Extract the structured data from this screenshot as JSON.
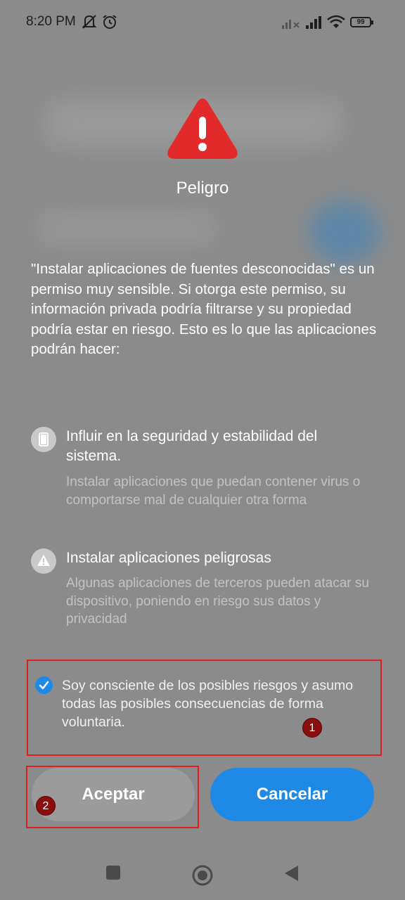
{
  "status_bar": {
    "time": "8:20 PM",
    "icons": [
      "muted-icon",
      "alarm-icon",
      "signal-off-icon",
      "signal-icon",
      "wifi-icon"
    ],
    "battery": "99"
  },
  "dialog": {
    "title": "Peligro",
    "description": "\"Instalar aplicaciones de fuentes desconocidas\" es un permiso muy sensible. Si otorga este permiso, su información privada podría filtrarse y su propiedad podría estar en riesgo. Esto es lo que las aplicaciones podrán hacer:",
    "items": [
      {
        "icon": "phone-icon",
        "title": "Influir en la seguridad y estabilidad del sistema.",
        "description": "Instalar aplicaciones que puedan contener virus o comportarse mal de cualquier otra forma"
      },
      {
        "icon": "warning-icon",
        "title": "Instalar aplicaciones peligrosas",
        "description": "Algunas aplicaciones de terceros pueden atacar su dispositivo, poniendo en riesgo sus datos y privacidad"
      }
    ],
    "consent": {
      "text": "Soy consciente de los posibles riesgos y asumo todas las posibles consecuencias de forma voluntaria.",
      "checked": true
    },
    "buttons": {
      "accept": "Aceptar",
      "cancel": "Cancelar"
    }
  },
  "annotations": {
    "badge1": "1",
    "badge2": "2"
  },
  "colors": {
    "accent": "#1e8ae6",
    "danger": "#e32a2a",
    "highlight": "#e01e1e"
  }
}
